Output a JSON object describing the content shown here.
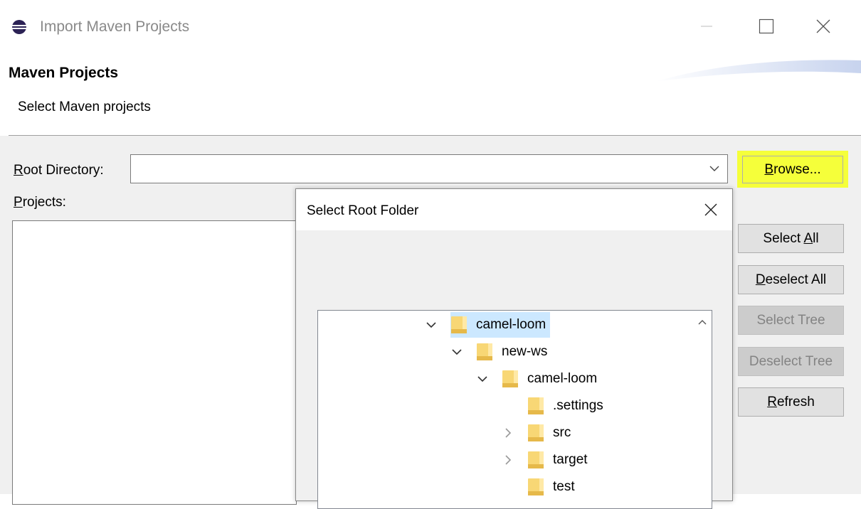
{
  "window": {
    "title": "Import Maven Projects",
    "icon": "eclipse-icon",
    "controls": [
      "minimize-icon",
      "maximize-icon",
      "close-icon"
    ]
  },
  "header": {
    "title": "Maven Projects",
    "subtitle": "Select Maven projects"
  },
  "form": {
    "root_directory_label": "Root Directory:",
    "root_directory_value": "",
    "browse_label": "Browse...",
    "projects_label": "Projects:"
  },
  "side_buttons": {
    "select_all": "Select All",
    "deselect_all": "Deselect All",
    "select_tree": "Select Tree",
    "deselect_tree": "Deselect Tree",
    "refresh": "Refresh"
  },
  "dialog": {
    "title": "Select Root Folder",
    "tree": [
      {
        "label": "camel-loom",
        "depth": 0,
        "state": "expanded",
        "selected": true
      },
      {
        "label": "new-ws",
        "depth": 1,
        "state": "expanded",
        "selected": false
      },
      {
        "label": "camel-loom",
        "depth": 2,
        "state": "expanded",
        "selected": false
      },
      {
        "label": ".settings",
        "depth": 3,
        "state": "leaf",
        "selected": false
      },
      {
        "label": "src",
        "depth": 3,
        "state": "collapsed",
        "selected": false
      },
      {
        "label": "target",
        "depth": 3,
        "state": "collapsed",
        "selected": false
      },
      {
        "label": "test",
        "depth": 3,
        "state": "leaf",
        "selected": false
      }
    ]
  },
  "colors": {
    "highlight": "#f5ff3a",
    "selection": "#cce8ff",
    "folder": "#f8d775",
    "dialog_bg": "#f0f0f0"
  }
}
